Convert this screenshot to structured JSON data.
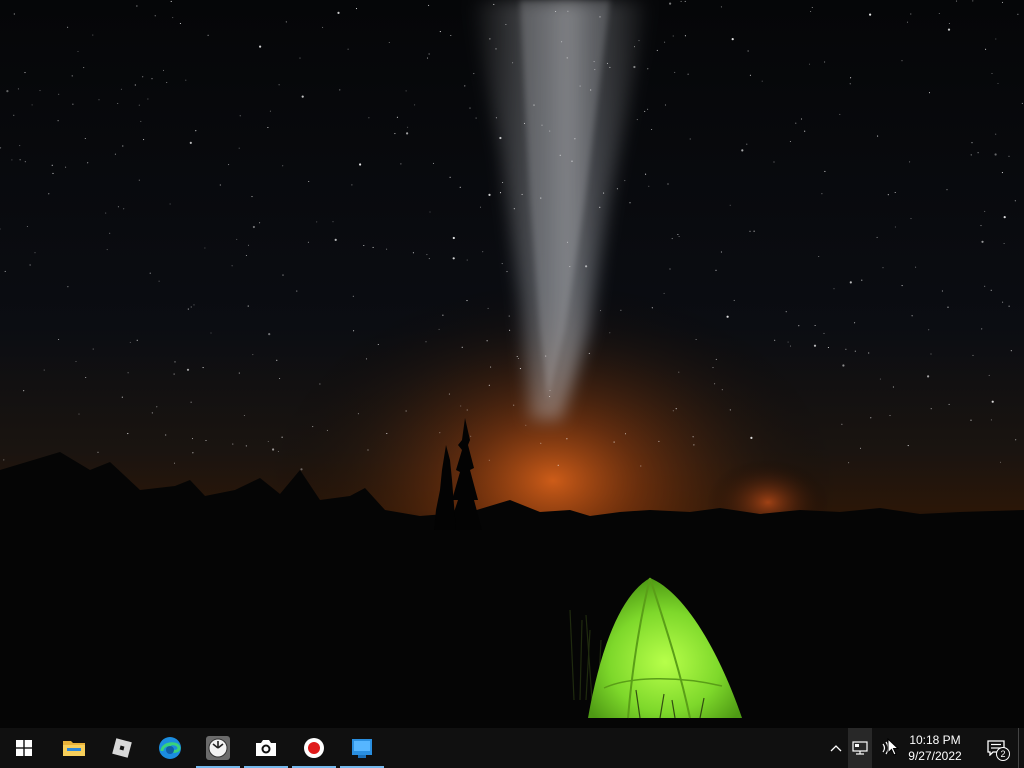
{
  "desktop": {
    "wallpaper_icon": "night-sky-tent-wallpaper"
  },
  "taskbar": {
    "start_icon": "windows-logo-icon",
    "pinned": [
      {
        "name": "file-explorer",
        "icon": "folder-icon",
        "running": false
      },
      {
        "name": "roblox",
        "icon": "roblox-icon",
        "running": false
      },
      {
        "name": "edge",
        "icon": "edge-icon",
        "running": false
      },
      {
        "name": "clock-app",
        "icon": "clock-icon",
        "running": true
      },
      {
        "name": "camera",
        "icon": "camera-icon",
        "running": true
      },
      {
        "name": "recorder",
        "icon": "record-icon",
        "running": true
      },
      {
        "name": "app-window",
        "icon": "app-window-icon",
        "running": true
      }
    ],
    "tray": {
      "overflow_icon": "chevron-up-icon",
      "network_icon": "network-icon",
      "volume_icon": "volume-icon",
      "time": "10:18 PM",
      "date": "9/27/2022",
      "notification_icon": "action-center-icon",
      "notification_count": "2"
    }
  },
  "colors": {
    "taskbar_bg": "#101010",
    "running_indicator": "#76b9ed",
    "tent_green": "#8fe03a",
    "horizon_glow": "#d9641e"
  }
}
